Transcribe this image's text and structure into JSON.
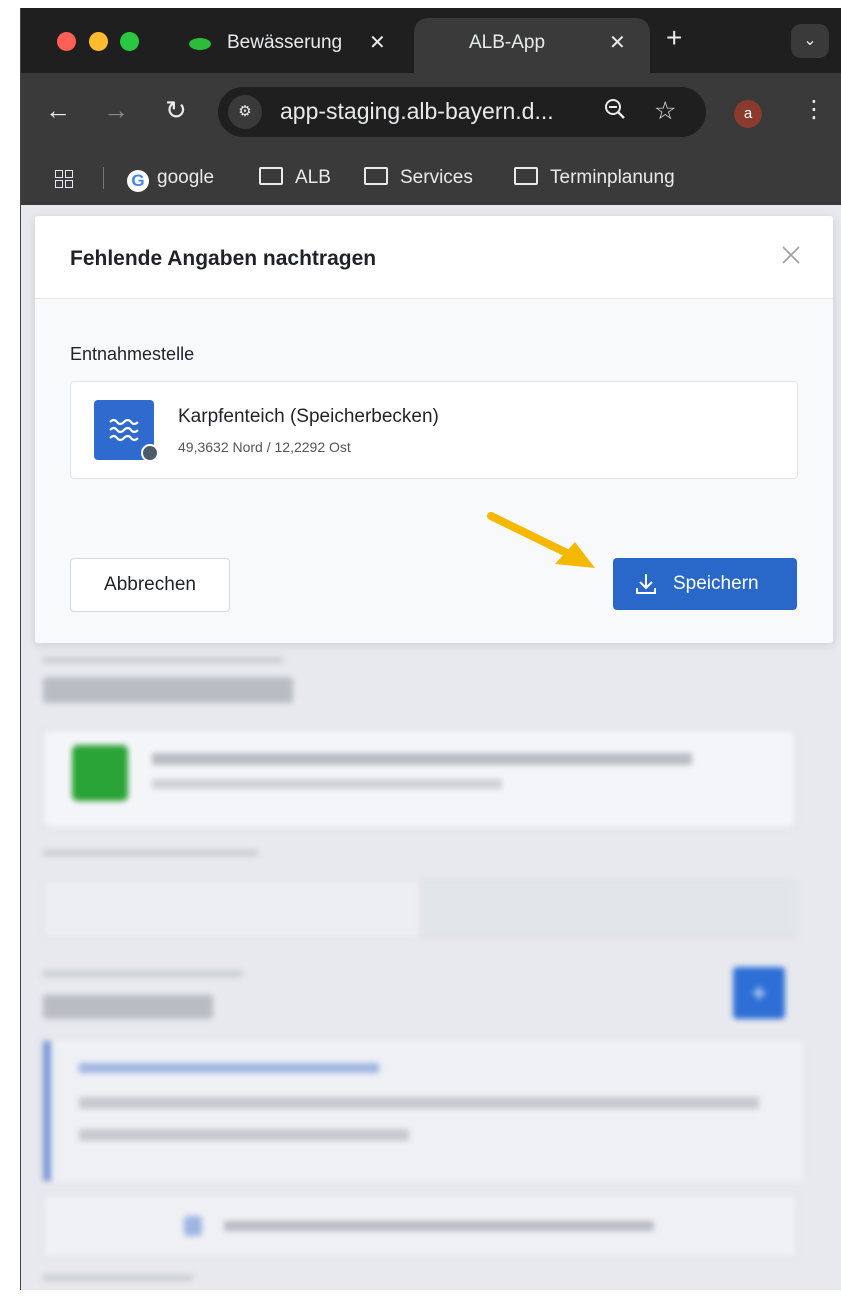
{
  "browser": {
    "tabs": [
      {
        "label": "Bewässerung",
        "close": "✕"
      },
      {
        "label": "ALB-App",
        "close": "✕"
      }
    ],
    "new_tab": "+",
    "tab_menu": "⌄",
    "url": "app-staging.alb-bayern.d...",
    "avatar_letter": "a",
    "bookmarks": [
      "google",
      "ALB",
      "Services",
      "Terminplanung"
    ]
  },
  "modal": {
    "title": "Fehlende Angaben nachtragen",
    "section_label": "Entnahmestelle",
    "location": {
      "name": "Karpfenteich (Speicherbecken)",
      "coords": "49,3632 Nord / 12,2292 Ost"
    },
    "cancel_label": "Abbrechen",
    "save_label": "Speichern"
  },
  "colors": {
    "primary": "#2968c8",
    "annotation_arrow": "#f5b800"
  }
}
